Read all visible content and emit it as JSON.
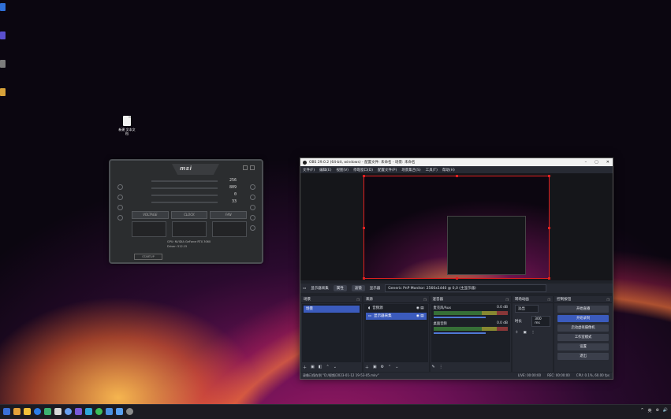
{
  "desktop": {
    "file_label": "新建 文本文档",
    "icon_colors": [
      "#2f6fd8",
      "#5a4fcf",
      "#d8a23a",
      "#7c7c7c"
    ]
  },
  "msi": {
    "brand": "msi",
    "stats": [
      "256",
      "809",
      "0",
      "33"
    ],
    "tabs": [
      "VOLTAGE",
      "CLOCK",
      "FAN"
    ],
    "info_lines": [
      "GPU: NVIDIA GeForce RTX 3060",
      "Driver: 512.15"
    ],
    "startup_label": "STARTUP"
  },
  "obs": {
    "title": "OBS 29.0.2 (64-bit, windows) - 配置文件: 未命名 - 场景: 未命名",
    "window_controls": [
      "–",
      "▢",
      "✕"
    ],
    "menu": [
      "文件(F)",
      "编辑(E)",
      "视图(V)",
      "停靠窗口(D)",
      "配置文件(P)",
      "场景集合(S)",
      "工具(T)",
      "帮助(H)"
    ],
    "source_bar": {
      "source_name": "显示器采集",
      "properties": "属性",
      "filters": "滤镜",
      "display_label": "显示器",
      "display_value": "Generic PnP Monitor: 2560x1440 @ 0,0 (主显示器)"
    },
    "docks": {
      "scenes": {
        "title": "场景",
        "items": [
          "场景"
        ]
      },
      "sources": {
        "title": "来源",
        "items": [
          "音频源",
          "显示器采集"
        ]
      },
      "mixer": {
        "title": "混音器",
        "channels": [
          {
            "name": "麦克风/Aux",
            "db": "0.0 dB"
          },
          {
            "name": "桌面音频",
            "db": "0.0 dB"
          }
        ]
      },
      "transitions": {
        "title": "转场动画",
        "type": "淡出",
        "duration_label": "时长",
        "duration_value": "300 ms"
      },
      "controls": {
        "title": "控制按钮",
        "buttons": [
          "开始直播",
          "开始录制",
          "启动虚拟摄像机",
          "工作室模式",
          "设置",
          "退出"
        ],
        "active_index": 1
      }
    },
    "status": {
      "left": "录像已保存到 \"D:/视频/2023-01-12 19-53-05.mkv\"",
      "live": "LIVE: 00:00:00",
      "rec": "REC: 00:00:00",
      "cpu": "CPU: 0.1%, 60.00 fps"
    }
  },
  "taskbar": {
    "icon_colors": [
      "#3a6fd8",
      "#e5a13a",
      "#f3c13a",
      "#2b7de9",
      "#3cb371",
      "#d8d8d8",
      "#6aa0f0",
      "#7a5ad8",
      "#2fa8d8",
      "#3cbf5a",
      "#4a90e2",
      "#5aa0f0",
      "#8a8a8a"
    ],
    "tray_items": [
      "^",
      "英",
      "⊕",
      "🔊"
    ]
  }
}
